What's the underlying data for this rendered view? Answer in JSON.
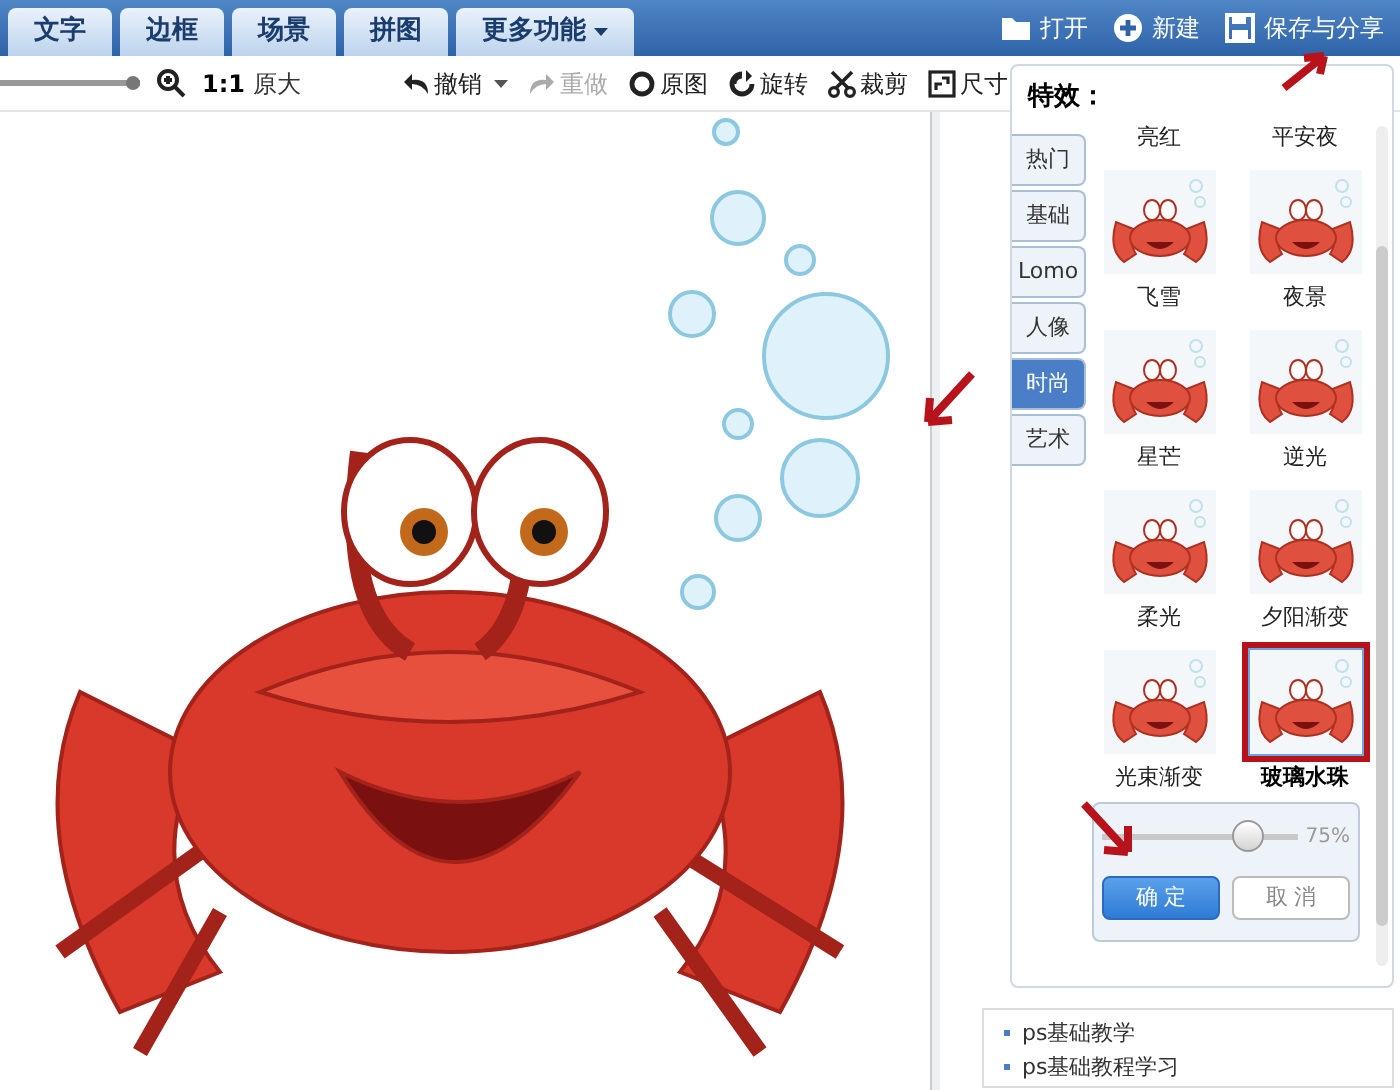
{
  "top_tabs": [
    {
      "label": "文字",
      "kind": "tab"
    },
    {
      "label": "边框",
      "kind": "tab"
    },
    {
      "label": "场景",
      "kind": "tab"
    },
    {
      "label": "拼图",
      "kind": "tab"
    },
    {
      "label": "更多功能",
      "kind": "menu"
    }
  ],
  "top_actions": [
    {
      "label": "打开"
    },
    {
      "label": "新建"
    },
    {
      "label": "保存与分享"
    }
  ],
  "toolbar": {
    "zoom_slider": {
      "level": 1
    },
    "zoom_ratio": "1:1",
    "zoom_text": "原大",
    "tools": [
      {
        "label": "撤销",
        "disabled": false,
        "dropdown": true
      },
      {
        "label": "重做",
        "disabled": true,
        "dropdown": false
      },
      {
        "label": "原图",
        "disabled": false,
        "dropdown": false
      },
      {
        "label": "旋转",
        "disabled": false,
        "dropdown": false
      },
      {
        "label": "裁剪",
        "disabled": false,
        "dropdown": false
      },
      {
        "label": "尺寸",
        "disabled": false,
        "dropdown": false
      }
    ]
  },
  "effects_panel": {
    "title": "特效：",
    "categories": [
      {
        "label": "热门",
        "selected": false
      },
      {
        "label": "基础",
        "selected": false
      },
      {
        "label": "Lomo",
        "selected": false
      },
      {
        "label": "人像",
        "selected": false
      },
      {
        "label": "时尚",
        "selected": true
      },
      {
        "label": "艺术",
        "selected": false
      }
    ],
    "effects": [
      {
        "label": "亮红",
        "selected": false
      },
      {
        "label": "平安夜",
        "selected": false
      },
      {
        "label": "飞雪",
        "selected": false
      },
      {
        "label": "夜景",
        "selected": false
      },
      {
        "label": "星芒",
        "selected": false
      },
      {
        "label": "逆光",
        "selected": false
      },
      {
        "label": "柔光",
        "selected": false
      },
      {
        "label": "夕阳渐变",
        "selected": false
      },
      {
        "label": "光束渐变",
        "selected": false
      },
      {
        "label": "玻璃水珠",
        "selected": true
      }
    ],
    "strength": {
      "level": 0.75,
      "reading": "75%"
    },
    "buttons": [
      {
        "label": "确 定",
        "kind": "primary"
      },
      {
        "label": "取 消",
        "kind": "secondary"
      }
    ]
  },
  "links": [
    "ps基础教学",
    "ps基础教程学习"
  ]
}
